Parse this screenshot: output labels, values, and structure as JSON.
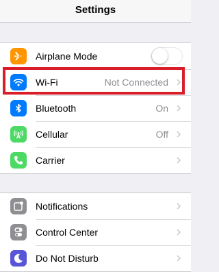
{
  "header": {
    "title": "Settings"
  },
  "group1": {
    "airplane": {
      "label": "Airplane Mode",
      "toggle_on": false,
      "icon": "airplane-icon",
      "color": "#ff9500"
    },
    "wifi": {
      "label": "Wi-Fi",
      "value": "Not Connected",
      "icon": "wifi-icon",
      "color": "#007aff"
    },
    "bluetooth": {
      "label": "Bluetooth",
      "value": "On",
      "icon": "bluetooth-icon",
      "color": "#007aff"
    },
    "cellular": {
      "label": "Cellular",
      "value": "Off",
      "icon": "cellular-antenna-icon",
      "color": "#4cd964"
    },
    "carrier": {
      "label": "Carrier",
      "value": "",
      "icon": "phone-icon",
      "color": "#4cd964"
    }
  },
  "group2": {
    "notifications": {
      "label": "Notifications",
      "icon": "notifications-icon",
      "color": "#8e8e93"
    },
    "control_center": {
      "label": "Control Center",
      "icon": "control-center-icon",
      "color": "#8e8e93"
    },
    "do_not_disturb": {
      "label": "Do Not Disturb",
      "icon": "moon-icon",
      "color": "#5856d6"
    }
  },
  "highlight_color": "#d91e2a"
}
